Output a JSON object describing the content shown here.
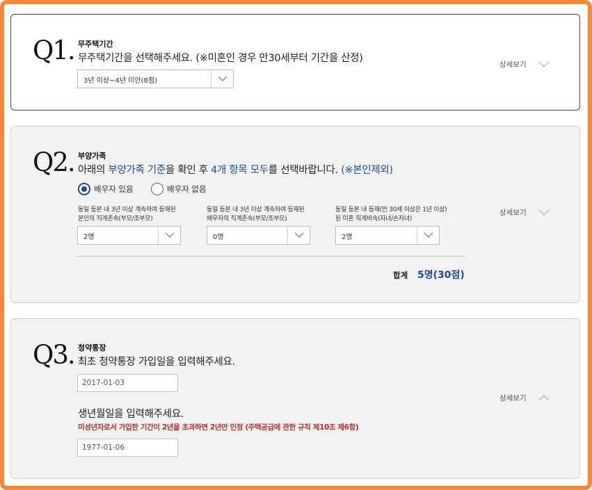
{
  "q1": {
    "number": "Q1.",
    "title": "무주택기간",
    "description": "무주택기간을 선택해주세요. (※미혼인 경우 만30세부터 기간을 산정)",
    "select_value": "3년 이상~4년 미만(8점)",
    "detail_label": "상세보기"
  },
  "q2": {
    "number": "Q2.",
    "title": "부양가족",
    "desc_parts": {
      "p1": "아래의 ",
      "h1": "부양가족 기준",
      "p2": "을 확인 후 ",
      "h2": "4개 항목 모두",
      "p3": "를 선택바랍니다. ",
      "h3": "(※본인제외)"
    },
    "radios": [
      {
        "label": "배우자 있음",
        "checked": true
      },
      {
        "label": "배우자 없음",
        "checked": false
      }
    ],
    "dependents": [
      {
        "label_line1": "동일 등본 내 3년 이상 계속하여 등재된",
        "label_line2": "본인의 직계존속(부모/조부모)",
        "value": "2명"
      },
      {
        "label_line1": "동일 등본 내 3년 이상 계속하여 등재된",
        "label_line2": "배우자의 직계존속(부모/조부모)",
        "value": "0명"
      },
      {
        "label_line1": "동일 등본 내 등재(만 30세 이상은 1년 이상)",
        "label_line2": "된 미혼 직계비속(자녀/손자녀)",
        "value": "2명"
      }
    ],
    "total_label": "합계",
    "total_value": "5명(30점)",
    "detail_label": "상세보기"
  },
  "q3": {
    "number": "Q3.",
    "title": "청약통장",
    "description": "최초 청약통장 가입일을 입력해주세요.",
    "join_date": "2017-01-03",
    "birth_question": "생년월일을 입력해주세요.",
    "warning": "미성년자로서 가입한 기간이 2년을 초과하면 2년만 인정 (주택공급에 관한 규칙 제10조 제6항)",
    "birth_date": "1977-01-06",
    "detail_label": "상세보기"
  },
  "colors": {
    "frame": "#f5883a",
    "accent": "#1e4a96",
    "warning": "#b03030"
  }
}
